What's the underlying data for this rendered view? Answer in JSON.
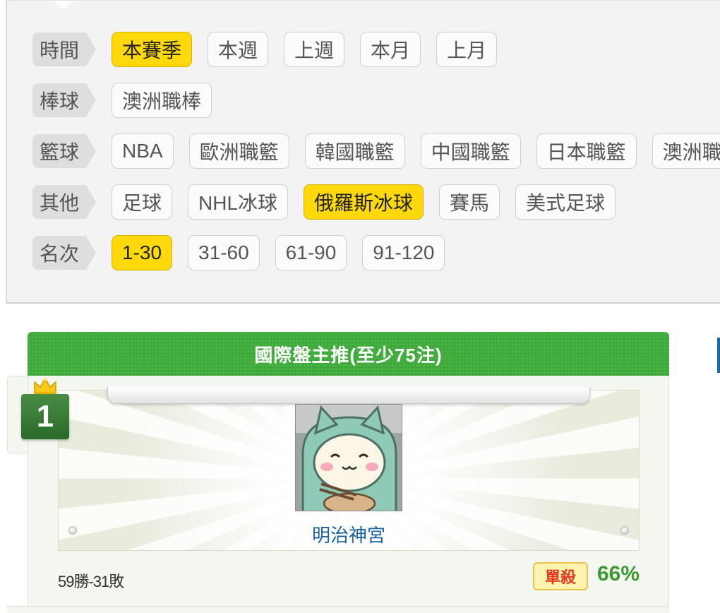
{
  "filters": {
    "time": {
      "label": "時間",
      "options": [
        "本賽季",
        "本週",
        "上週",
        "本月",
        "上月"
      ],
      "active": "本賽季"
    },
    "baseball": {
      "label": "棒球",
      "options": [
        "澳洲職棒"
      ]
    },
    "basketball": {
      "label": "籃球",
      "options": [
        "NBA",
        "歐洲職籃",
        "韓國職籃",
        "中國職籃",
        "日本職籃",
        "澳洲職"
      ]
    },
    "other": {
      "label": "其他",
      "options": [
        "足球",
        "NHL冰球",
        "俄羅斯冰球",
        "賽馬",
        "美式足球"
      ],
      "active": "俄羅斯冰球"
    },
    "rank": {
      "label": "名次",
      "options": [
        "1-30",
        "31-60",
        "61-90",
        "91-120"
      ],
      "active": "1-30"
    }
  },
  "card": {
    "title": "國際盤主推(至少75注)",
    "rank": "1",
    "user_name": "明治神宮",
    "record": "59勝-31敗",
    "tag": "單殺",
    "win_rate": "66%"
  },
  "colors": {
    "active_chip": "#fdd80a",
    "header_green": "#3eaa39",
    "rank_green": "#2a6a2a",
    "name_blue": "#1a5fa0",
    "rate_green": "#3a9a30",
    "tag_red": "#e23a1f"
  },
  "icons": {
    "crown": "crown-icon",
    "avatar": "cartoon-avatar"
  }
}
